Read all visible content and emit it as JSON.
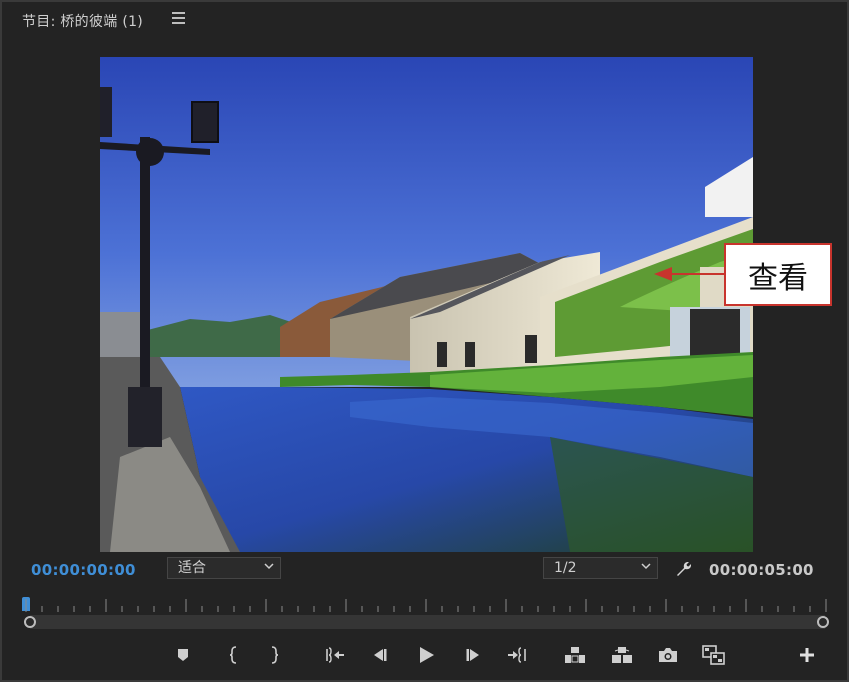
{
  "panel": {
    "title": "节目: 桥的彼端 (1)",
    "menu_icon": "hamburger-menu-icon"
  },
  "annotation": {
    "label": "查看",
    "border_color": "#c8342d"
  },
  "timecode": {
    "current": "00:00:00:00",
    "duration": "00:00:05:00",
    "current_color": "#3f8ed6"
  },
  "zoom_select": {
    "value": "适合"
  },
  "resolution_select": {
    "value": "1/2"
  },
  "transport": {
    "buttons": [
      "add-marker-icon",
      "mark-in-icon",
      "mark-out-icon",
      "go-to-in-icon",
      "step-back-icon",
      "play-icon",
      "step-forward-icon",
      "go-to-out-icon",
      "lift-icon",
      "extract-icon",
      "export-frame-icon",
      "comparison-view-icon",
      "add-button-icon"
    ]
  },
  "colors": {
    "background": "#232323",
    "accent": "#3f8ed6"
  }
}
